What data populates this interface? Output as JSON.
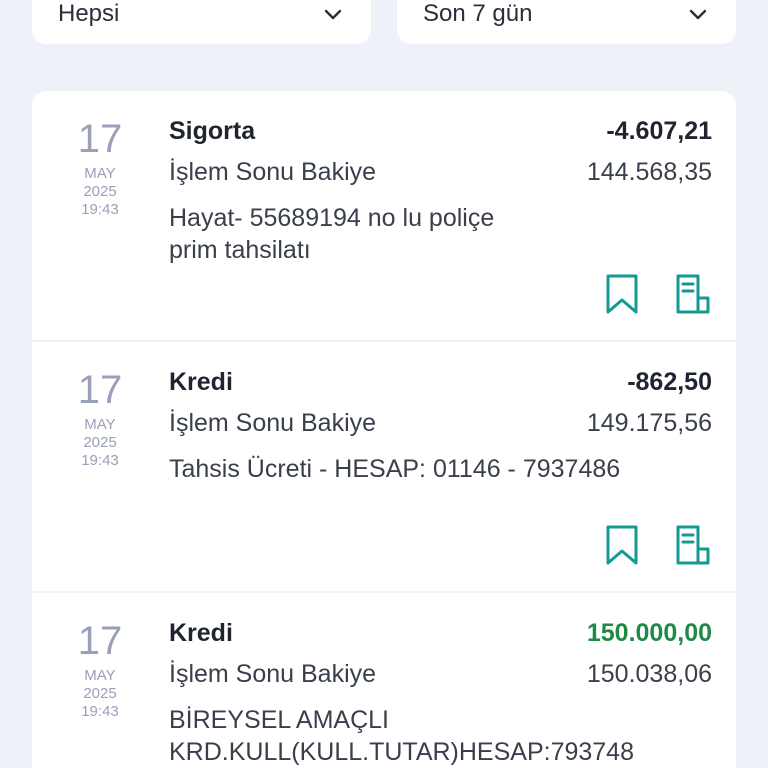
{
  "filters": {
    "type_label": "Hepsi",
    "period_label": "Son 7 gün"
  },
  "colors": {
    "accent_teal": "#159a93",
    "positive_green": "#1f8a45",
    "date_gray": "#9aa0b8"
  },
  "transactions": [
    {
      "day": "17",
      "month": "MAY",
      "year": "2025",
      "time": "19:43",
      "title": "Sigorta",
      "amount": "-4.607,21",
      "balance_label": "İşlem Sonu Bakiye",
      "balance": "144.568,35",
      "description": "Hayat- 55689194 no lu poliçe\nprim tahsilatı"
    },
    {
      "day": "17",
      "month": "MAY",
      "year": "2025",
      "time": "19:43",
      "title": "Kredi",
      "amount": "-862,50",
      "balance_label": "İşlem Sonu Bakiye",
      "balance": "149.175,56",
      "description": "Tahsis Ücreti - HESAP: 01146 - 7937486"
    },
    {
      "day": "17",
      "month": "MAY",
      "year": "2025",
      "time": "19:43",
      "title": "Kredi",
      "amount": "150.000,00",
      "balance_label": "İşlem Sonu Bakiye",
      "balance": "150.038,06",
      "description": "BİREYSEL AMAÇLI\nKRD.KULL(KULL.TUTAR)HESAP:793748"
    }
  ],
  "icons": {
    "bookmark": "bookmark-icon",
    "receipt": "receipt-icon",
    "chevron": "chevron-down-icon"
  }
}
